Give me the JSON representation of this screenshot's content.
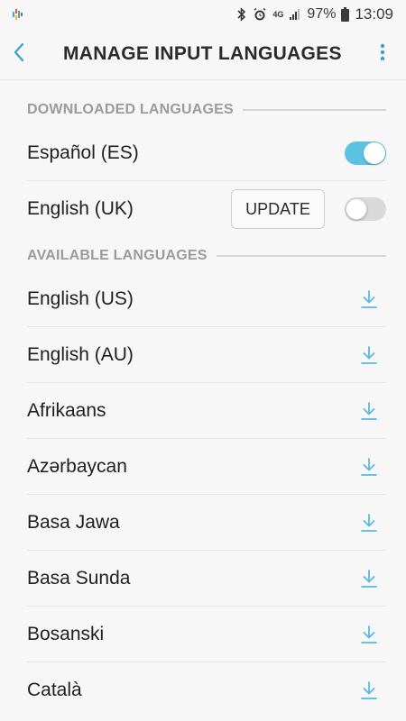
{
  "status_bar": {
    "battery": "97%",
    "time": "13:09",
    "network": "4G"
  },
  "app_bar": {
    "title": "MANAGE INPUT LANGUAGES"
  },
  "downloaded": {
    "header": "DOWNLOADED LANGUAGES",
    "items": [
      {
        "label": "Español (ES)",
        "enabled": true
      },
      {
        "label": "English (UK)",
        "enabled": false,
        "action": "UPDATE"
      }
    ]
  },
  "available": {
    "header": "AVAILABLE LANGUAGES",
    "items": [
      {
        "label": "English (US)"
      },
      {
        "label": "English (AU)"
      },
      {
        "label": "Afrikaans"
      },
      {
        "label": "Azərbaycan"
      },
      {
        "label": "Basa Jawa"
      },
      {
        "label": "Basa Sunda"
      },
      {
        "label": "Bosanski"
      },
      {
        "label": "Català"
      }
    ]
  },
  "colors": {
    "accent": "#5bc2e2",
    "background": "#f7f7f7",
    "section_header": "#9b9b9b"
  },
  "icons": {
    "back": "back-arrow-icon",
    "more": "more-vert-icon",
    "download": "download-icon"
  }
}
